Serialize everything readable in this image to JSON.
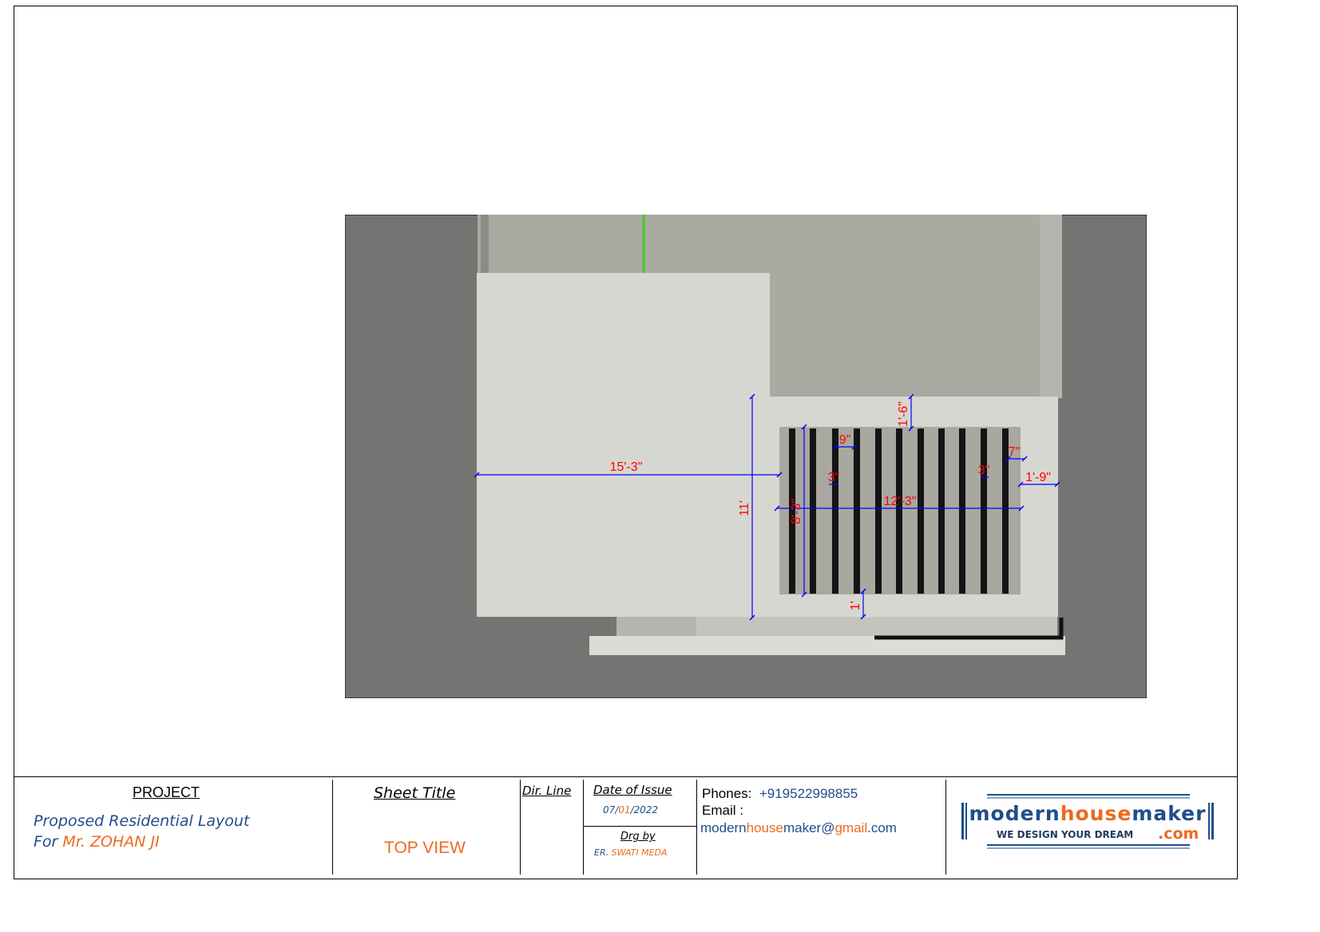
{
  "drawing": {
    "dimensions": {
      "overall_width": "15'-3\"",
      "total_depth": "11'",
      "inner_depth": "8'-3\"",
      "grill_width": "12'-3\"",
      "top_margin": "1'-6\"",
      "bottom_margin": "1'",
      "right_margin": "1'-9\"",
      "bar_spacing": "9\"",
      "bar_width_left": "3\"",
      "bar_width_right": "3\"",
      "end_gap": "7\""
    }
  },
  "title_block": {
    "project_heading": "PROJECT",
    "project_line1": "Proposed Residential Layout",
    "project_for": "For",
    "client": "Mr. ZOHAN JI",
    "sheet_title_heading": "Sheet Title",
    "sheet_title": "TOP VIEW",
    "dir_line_heading": "Dir. Line",
    "date_heading": "Date of Issue",
    "date_day": "07/",
    "date_month": "01",
    "date_year": "/2022",
    "drg_by_heading": "Drg by",
    "drg_by_prefix": "ER.",
    "drg_by_name": "SWATI MEDA",
    "phones_label": "Phones:",
    "phone": "+919522998855",
    "email_label": "Email :",
    "email_p1": "modern",
    "email_p2": "house",
    "email_p3": "maker@",
    "email_p4": "gmail",
    "email_p5": ".com"
  },
  "logo": {
    "word_modern": "modern",
    "word_house": "house",
    "word_maker": "maker",
    "tagline": "WE DESIGN YOUR DREAM",
    "tld": ".com"
  },
  "colors": {
    "dimension_text": "#ff0000",
    "dimension_line": "#0000ff",
    "brand_blue": "#1f4e8c",
    "brand_orange": "#ee6a1f"
  }
}
